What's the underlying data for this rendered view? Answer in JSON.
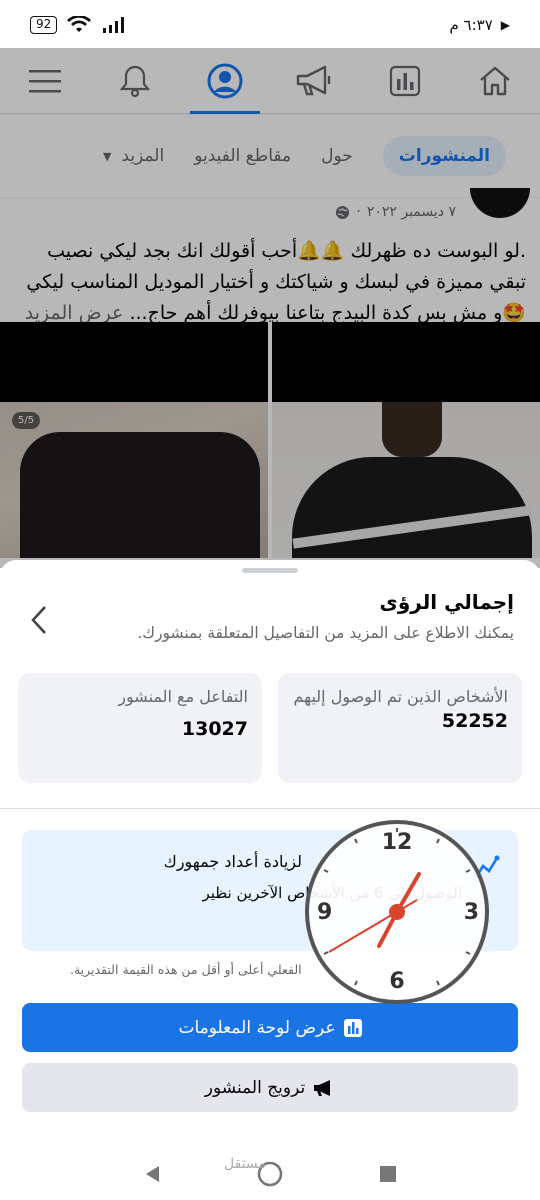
{
  "status_bar": {
    "time": "٦:٣٧ م",
    "battery": "92"
  },
  "nav": {
    "icons": [
      "home-icon",
      "chart-icon",
      "megaphone-icon",
      "profile-icon",
      "bell-icon",
      "menu-icon"
    ]
  },
  "tabs": {
    "items": [
      "المنشورات",
      "حول",
      "مقاطع الفيديو",
      "المزيد"
    ]
  },
  "post": {
    "date": "٧ ديسمبر ٢٠٢٢",
    "text": ".لو البوست ده ظهرلك 🔔🔔أحب أقولك انك بجد ليكي نصيب تبقي مميزة في لبسك و شياكتك و أختيار الموديل المناسب ليكي 🤩و مش بس كدة البيدج بتاعنا بيوفرلك أهم حاج...",
    "see_more": "عرض المزيد",
    "photo_counter": "5/5"
  },
  "sheet": {
    "title": "إجمالي الرؤى",
    "subtitle": "يمكنك الاطلاع على المزيد من التفاصيل المتعلقة بمنشورك.",
    "stats": [
      {
        "label": "الأشخاص الذين تم الوصول إليهم",
        "value": "52252"
      },
      {
        "label": "التفاعل مع المنشور",
        "value": "13027"
      }
    ],
    "promo": {
      "title": "لزيادة أعداد جمهورك",
      "body": "الوصول إلى 6 من الأشخاص الآخرين نظير"
    },
    "disclaimer": "الفعلي أعلى أو أقل من هذه القيمة التقديرية.",
    "primary_button": "عرض لوحة المعلومات",
    "secondary_button": "ترويج المنشور"
  },
  "clock": {
    "numbers": [
      "12",
      "3",
      "6",
      "9"
    ]
  },
  "watermark": "مستقل",
  "colors": {
    "accent": "#1877f2",
    "primary_button": "#1b74e4",
    "promo_bg": "#e7f3ff"
  }
}
